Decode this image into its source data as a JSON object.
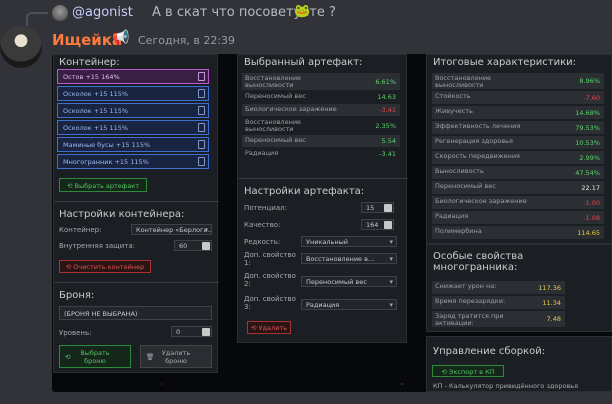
{
  "reply": {
    "username": "@agonist",
    "text": "А в скат что посоветуете ?",
    "emoji": "🐸"
  },
  "message": {
    "author": "Ищейка",
    "author_icon": "📢",
    "timestamp": "Сегодня, в 22:39"
  },
  "container_panel": {
    "title": "Контейнер:",
    "slots": [
      {
        "label": "Остов +15 164%",
        "active": true
      },
      {
        "label": "Осколок +15 115%",
        "active": false
      },
      {
        "label": "Осколок +15 115%",
        "active": false
      },
      {
        "label": "Осколок +15 115%",
        "active": false
      },
      {
        "label": "Маминые бусы +15 115%",
        "active": false
      },
      {
        "label": "Многогранник +15 115%",
        "active": false
      }
    ],
    "select_artifact_button": "⟲ Выбрать артефакт",
    "settings_title": "Настройки контейнера:",
    "container_label": "Контейнер:",
    "container_value": "Контейнер «Берлога...",
    "protection_label": "Внутренняя защита:",
    "protection_value": "60",
    "clear_button": "⟲ Очистить контейнер",
    "armor_title": "Броня:",
    "armor_value": "(БРОНЯ НЕ ВЫБРАНА)",
    "level_label": "Уровень:",
    "level_value": "0",
    "select_armor_button_line1": "Выбрать",
    "select_armor_button_line2": "броню",
    "delete_armor_button_line1": "Удалить",
    "delete_armor_button_line2": "броню"
  },
  "artifact_panel": {
    "title": "Выбранный артефакт:",
    "stats": [
      {
        "label": "Восстановление",
        "label2": "выносливости",
        "value": "6.61%",
        "color": "green",
        "shade": true,
        "tall": true
      },
      {
        "label": "Переносимый вес",
        "label2": "",
        "value": "14.63",
        "color": "green",
        "shade": false,
        "tall": false
      },
      {
        "label": "Биологическое заражение",
        "label2": "",
        "value": "-3.41",
        "color": "red",
        "shade": true,
        "tall": false
      },
      {
        "label": "Восстановление",
        "label2": "выносливости",
        "value": "2.35%",
        "color": "green",
        "shade": false,
        "tall": true
      },
      {
        "label": "Переносимый вес",
        "label2": "",
        "value": "5.54",
        "color": "green",
        "shade": true,
        "tall": false
      },
      {
        "label": "Радиация",
        "label2": "",
        "value": "-3.41",
        "color": "green",
        "shade": false,
        "tall": false
      }
    ],
    "settings_title": "Настройки артефакта:",
    "potential_label": "Потенциал:",
    "potential_value": "15",
    "quality_label": "Качество:",
    "quality_value": "164",
    "rarity_label": "Редкость:",
    "rarity_value": "Уникальный",
    "prop1_label": "Доп. свойство 1:",
    "prop1_value": "Восстановление в...",
    "prop2_label": "Доп. свойство 2:",
    "prop2_value": "Переносимый вес",
    "prop3_label": "Доп. свойство 3:",
    "prop3_value": "Радиация",
    "delete_button": "⟲ Удалить"
  },
  "totals_panel": {
    "title": "Итоговые характеристики:",
    "stats": [
      {
        "label": "Восстановление",
        "label2": "выносливости",
        "value": "8.96%",
        "color": "green",
        "tall": true
      },
      {
        "label": "Стойкость",
        "value": "-7.60",
        "color": "red"
      },
      {
        "label": "Живучесть",
        "value": "14.68%",
        "color": "green"
      },
      {
        "label": "Эффективность лечения",
        "value": "79.53%",
        "color": "green"
      },
      {
        "label": "Регенерация здоровья",
        "value": "10.53%",
        "color": "green"
      },
      {
        "label": "Скорость передвижения",
        "value": "2.99%",
        "color": "green"
      },
      {
        "label": "Выносливость",
        "value": "47.54%",
        "color": "green"
      },
      {
        "label": "Переносимый вес",
        "value": "22.17",
        "color": "white"
      },
      {
        "label": "Биологическое заражение",
        "value": "-1.00",
        "color": "red"
      },
      {
        "label": "Радиация",
        "value": "-1.08",
        "color": "red"
      },
      {
        "label": "Полимербина",
        "value": "114.65",
        "color": "yellow"
      }
    ]
  },
  "special_panel": {
    "title_line1": "Особые свойства",
    "title_line2": "многогранника:",
    "stats": [
      {
        "label": "Снижает урон на:",
        "value": "117.36"
      },
      {
        "label": "Время перезарядки:",
        "value": "11.34"
      },
      {
        "label": "Заряд тратится при",
        "label2": "активации:",
        "value": "7.48"
      }
    ]
  },
  "manage_panel": {
    "title": "Управление сборкой:",
    "export_button": "⟲ Экспорт в КП",
    "footer": "КП - Калькулятор привидённого здоровья"
  }
}
